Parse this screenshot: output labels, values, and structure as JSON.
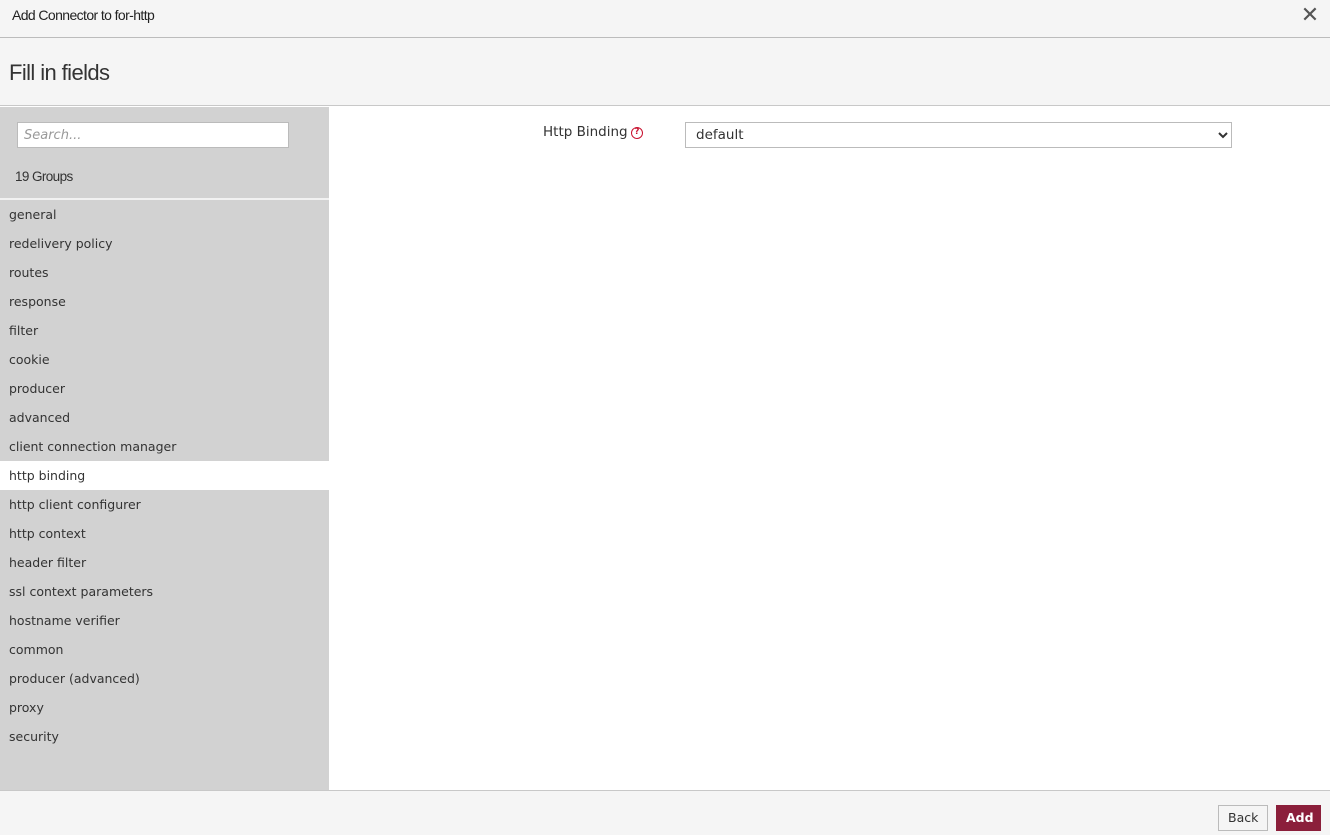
{
  "window": {
    "title": "Add Connector to for-http",
    "close_icon": "close-icon"
  },
  "header": {
    "title": "Fill in fields"
  },
  "sidebar": {
    "search": {
      "placeholder": "Search...",
      "value": ""
    },
    "groups_count": "19 Groups",
    "active_group": "http binding",
    "groups": [
      {
        "label": "general"
      },
      {
        "label": "redelivery policy"
      },
      {
        "label": "routes"
      },
      {
        "label": "response"
      },
      {
        "label": "filter"
      },
      {
        "label": "cookie"
      },
      {
        "label": "producer"
      },
      {
        "label": "advanced"
      },
      {
        "label": "client connection manager"
      },
      {
        "label": "http binding"
      },
      {
        "label": "http client configurer"
      },
      {
        "label": "http context"
      },
      {
        "label": "header filter"
      },
      {
        "label": "ssl context parameters"
      },
      {
        "label": "hostname verifier"
      },
      {
        "label": "common"
      },
      {
        "label": "producer (advanced)"
      },
      {
        "label": "proxy"
      },
      {
        "label": "security"
      }
    ]
  },
  "form": {
    "fields": [
      {
        "label": "Http Binding",
        "help_icon": "help-circle-icon",
        "selected": "default",
        "options": [
          "default"
        ]
      }
    ]
  },
  "footer": {
    "back_label": "Back",
    "add_label": "Add"
  },
  "colors": {
    "accent": "#8b1f3b",
    "help": "#c8102e",
    "sidebar_bg": "#d2d2d2",
    "header_bg": "#f5f5f5"
  }
}
